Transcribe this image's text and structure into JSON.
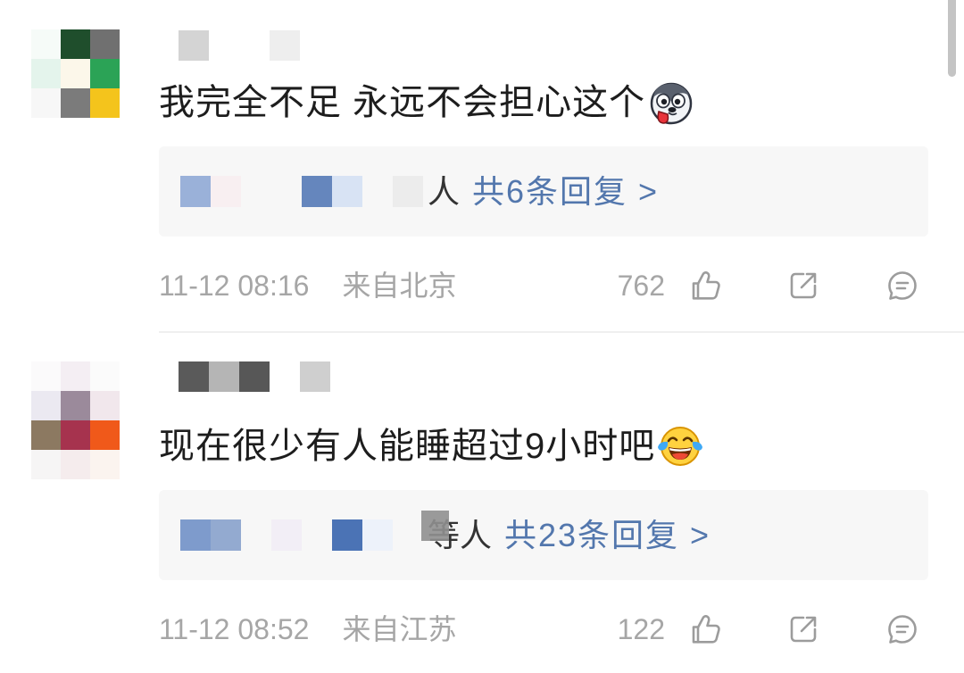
{
  "colors": {
    "text": "#1d1d1d",
    "meta": "#a6a6a6",
    "link": "#5377ad",
    "reply_bg": "#f7f7f7",
    "divider": "#efefef",
    "icon": "#9c9c9c",
    "scrollbar": "#c4c4c4",
    "background": "#ffffff",
    "names": "#333333"
  },
  "comments": [
    {
      "avatar_mosaic": [
        "#f6fbf8",
        "#1f4e2c",
        "#707070",
        "#e4f4ec",
        "#fcf7ea",
        "#2ba356",
        "#f7f7f7",
        "#7b7b7b",
        "#f4c41c"
      ],
      "username_mosaic": [
        "#d4d4d4",
        "#ffffff",
        "#ffffff",
        "#eeeeee",
        "#ffffff"
      ],
      "text": "我完全不足 永远不会担心这个",
      "emoji_icon": "doge-emoji",
      "reply_preview": {
        "name_mosaic": [
          "#9ab1d9",
          "#f8eff1",
          "#f7f7f7",
          "#f7f7f7",
          "#6586bd",
          "#d8e3f4",
          "#f7f7f7",
          "#ececec"
        ],
        "names_suffix": "人",
        "summary": "共6条回复 >"
      },
      "time": "11-12 08:16",
      "location": "来自北京",
      "like_count": "762",
      "actions": {
        "like_icon": "thumbs-up-icon",
        "share_icon": "share-icon",
        "comment_icon": "comment-icon"
      }
    },
    {
      "avatar_mosaic": [
        "#fbfafb",
        "#f4eef3",
        "#fbfbfb",
        "#ebe9f1",
        "#9b8a9b",
        "#f1e7ec",
        "#8c7961",
        "#a6334e",
        "#f0591a",
        "#f6f5f5",
        "#f5eced",
        "#fbf4ef"
      ],
      "username_mosaic": [
        "#5a5a5a",
        "#b5b5b5",
        "#575757",
        "#ffffff",
        "#cfcfcf"
      ],
      "text": "现在很少有人能睡超过9小时吧",
      "emoji_icon": "laughing-crying-emoji",
      "reply_preview": {
        "name_mosaic": [
          "#7e9bcc",
          "#93aad0",
          "#f7f7f7",
          "#f2eef6",
          "#f7f7f7",
          "#4b73b5",
          "#edf2fa",
          "#f7f7f7"
        ],
        "censor_block": "#8f8f8f",
        "names_suffix": "等人",
        "summary": "共23条回复 >"
      },
      "time": "11-12 08:52",
      "location": "来自江苏",
      "like_count": "122",
      "actions": {
        "like_icon": "thumbs-up-icon",
        "share_icon": "share-icon",
        "comment_icon": "comment-icon"
      }
    }
  ]
}
